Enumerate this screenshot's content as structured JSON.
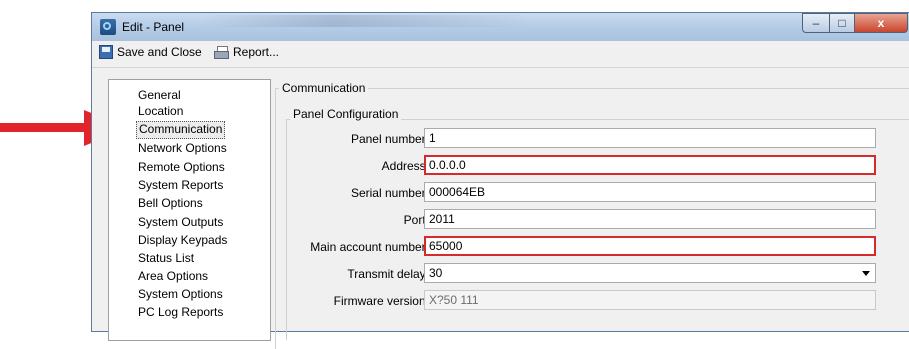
{
  "window": {
    "title": "Edit - Panel",
    "min_glyph": "‒",
    "max_glyph": "□",
    "close_glyph": "x"
  },
  "toolbar": {
    "save_label": "Save and Close",
    "report_label": "Report..."
  },
  "sidebar": {
    "selected": "Communication",
    "items": [
      {
        "label": "General"
      },
      {
        "label": "Location"
      },
      {
        "label": "Communication"
      },
      {
        "label": "Network Options"
      },
      {
        "label": "Remote Options"
      },
      {
        "label": "System Reports"
      },
      {
        "label": "Bell Options"
      },
      {
        "label": "System Outputs"
      },
      {
        "label": "Display Keypads"
      },
      {
        "label": "Status List"
      },
      {
        "label": "Area Options"
      },
      {
        "label": "System Options"
      },
      {
        "label": "PC Log Reports"
      }
    ]
  },
  "section": {
    "title": "Communication",
    "group_title": "Panel Configuration"
  },
  "form": {
    "panel_number": {
      "label": "Panel number:",
      "value": "1"
    },
    "address": {
      "label": "Address:",
      "value": "0.0.0.0"
    },
    "serial_number": {
      "label": "Serial number:",
      "value": "000064EB"
    },
    "port": {
      "label": "Port:",
      "value": "2011"
    },
    "main_account_number": {
      "label": "Main account number:",
      "value": "65000"
    },
    "transmit_delay": {
      "label": "Transmit delay:",
      "value": "30"
    },
    "firmware_version": {
      "label": "Firmware version:",
      "value": "X?50 111"
    }
  },
  "colors": {
    "highlight": "#d62b2b",
    "arrow": "#e0242a",
    "titlebar": "#b4cce6"
  },
  "icons": [
    "app-icon",
    "save-icon",
    "report-icon",
    "arrow-pointer-icon",
    "dropdown-arrow-icon"
  ]
}
